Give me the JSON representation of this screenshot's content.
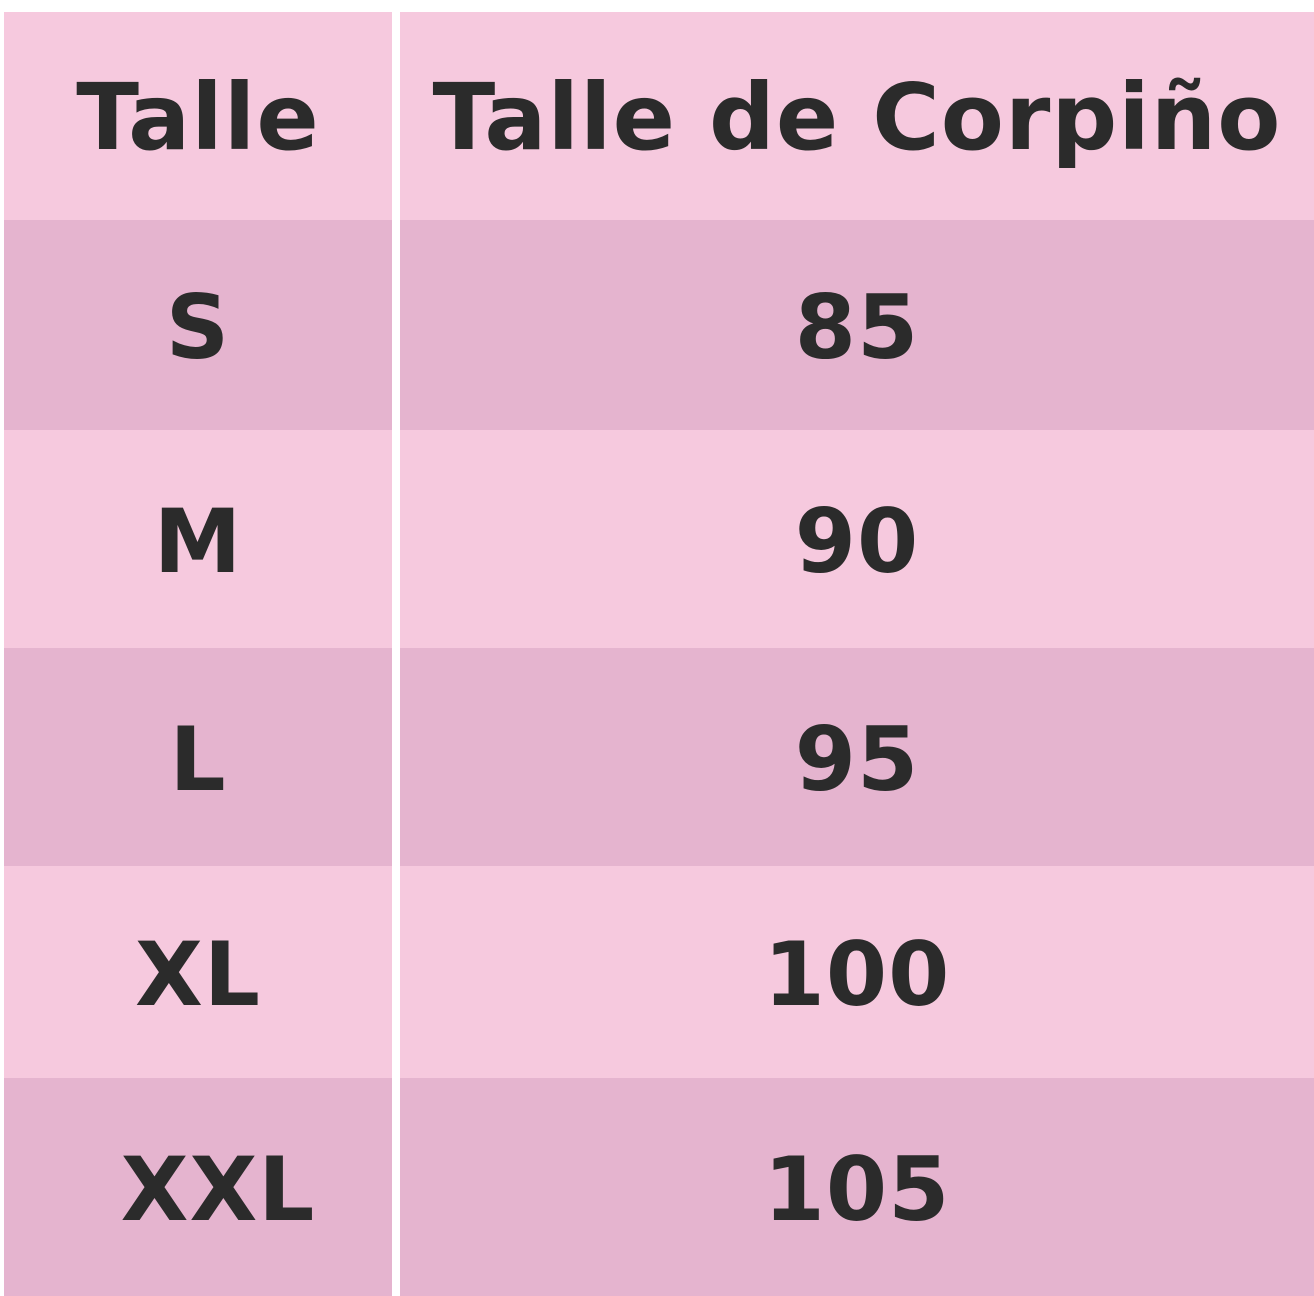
{
  "table": {
    "headers": [
      "Talle",
      "Talle de Corpiño"
    ],
    "rows": [
      {
        "talle": "S",
        "corpino": "85"
      },
      {
        "talle": "M",
        "corpino": "90"
      },
      {
        "talle": "L",
        "corpino": "95"
      },
      {
        "talle": "XL",
        "corpino": "100"
      },
      {
        "talle": "XXL",
        "corpino": "105"
      }
    ]
  },
  "colors": {
    "light_row": "#f6c9de",
    "dark_row": "#e5b4cf",
    "text": "#2b2b2b",
    "divider": "#ffffff"
  }
}
